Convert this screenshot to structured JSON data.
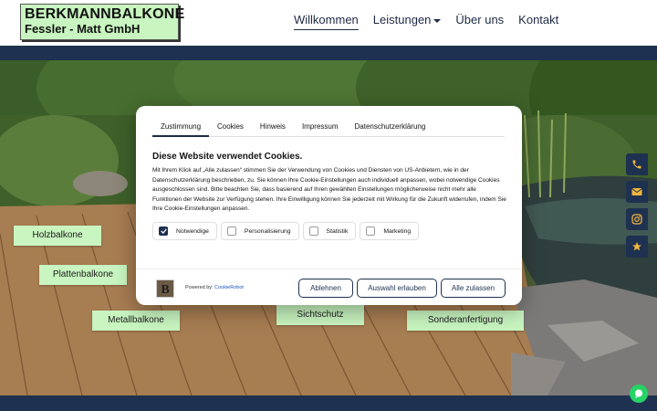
{
  "header": {
    "logo_line1": "BERKMANNBALKONE",
    "logo_line2": "Fessler - Matt GmbH",
    "nav": [
      {
        "label": "Willkommen",
        "active": true
      },
      {
        "label": "Leistungen",
        "dropdown": true
      },
      {
        "label": "Über uns"
      },
      {
        "label": "Kontakt"
      }
    ]
  },
  "hero": {
    "categories": [
      "Holzbalkone",
      "Plattenbalkone",
      "Metallbalkone",
      "Sichtschutz",
      "Sonderanfertigung"
    ]
  },
  "side_buttons": [
    "phone-icon",
    "envelope-icon",
    "instagram-icon",
    "star-icon"
  ],
  "cookie_dialog": {
    "tabs": [
      "Zustimmung",
      "Cookies",
      "Hinweis",
      "Impressum",
      "Datenschutzerklärung"
    ],
    "title": "Diese Website verwendet Cookies.",
    "body": "Mit Ihrem Klick auf „Alle zulassen“ stimmen Sie der Verwendung von Cookies und Diensten von US-Anbietern, wie in der Datenschutzerklärung beschrieben, zu. Sie können Ihre Cookie-Einstellungen auch individuell anpassen, wobei notwendige Cookies ausgeschlossen sind. Bitte beachten Sie, dass basierend auf Ihren gewählten Einstellungen möglicherweise nicht mehr alle Funktionen der Website zur Verfügung stehen. Ihre Einwilligung können Sie jederzeit mit Wirkung für die Zukunft widerrufen, indem Sie Ihre Cookie-Einstellungen anpassen.",
    "consents": [
      {
        "label": "Notwendige",
        "checked": true
      },
      {
        "label": "Personalisierung",
        "checked": false
      },
      {
        "label": "Statistik",
        "checked": false
      },
      {
        "label": "Marketing",
        "checked": false
      }
    ],
    "logo_letter": "B",
    "powered_by": "Powered by:",
    "powered_link": "CookieRobot",
    "buttons": {
      "reject": "Ablehnen",
      "allow_selection": "Auswahl erlauben",
      "allow_all": "Alle zulassen"
    }
  },
  "colors": {
    "navy": "#1e3150",
    "mint": "#c8f5c0",
    "star": "#f2b63c",
    "chat": "#25d366"
  }
}
